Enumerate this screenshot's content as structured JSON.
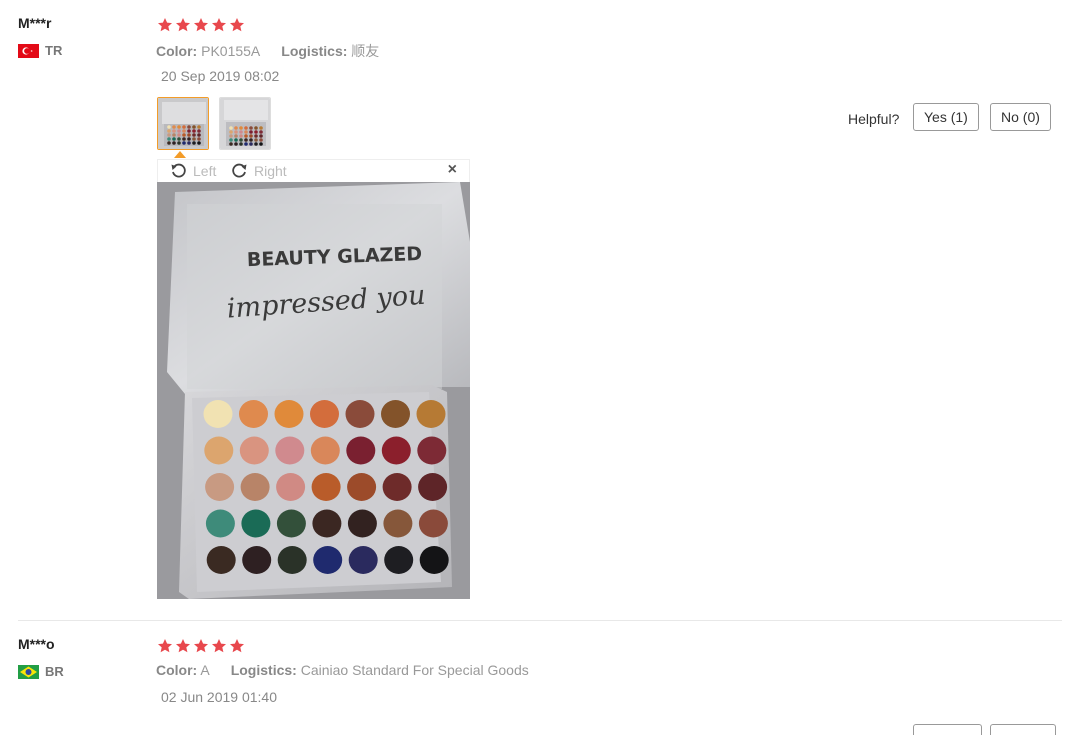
{
  "reviews": [
    {
      "user": "M***r",
      "country": "TR",
      "rating": 5,
      "color_label": "Color:",
      "color_value": "PK0155A",
      "logistics_label": "Logistics:",
      "logistics_value": "顺友",
      "date": "20 Sep 2019 08:02",
      "helpful_label": "Helpful?",
      "yes_label": "Yes (1)",
      "no_label": "No (0)",
      "viewer": {
        "rotate_left": "Left",
        "rotate_right": "Right",
        "close": "×"
      },
      "photo_text": {
        "brand": "BEAUTY GLAZED",
        "script": "impressed you"
      }
    },
    {
      "user": "M***o",
      "country": "BR",
      "rating": 5,
      "color_label": "Color:",
      "color_value": "A",
      "logistics_label": "Logistics:",
      "logistics_value": "Cainiao Standard For Special Goods",
      "date": "02 Jun 2019 01:40"
    }
  ],
  "colors": {
    "star": "#e8484d",
    "accent": "#f39c28"
  },
  "palette_colors": [
    [
      "#f1e2b2",
      "#df8a4e",
      "#e08a3a",
      "#d36d3c",
      "#8a4b3a",
      "#83532a",
      "#b67a34"
    ],
    [
      "#dca56e",
      "#d99480",
      "#d08a8e",
      "#d9875a",
      "#7a2030",
      "#8b1f2c",
      "#7d2a35"
    ],
    [
      "#c89a82",
      "#b88468",
      "#d08a84",
      "#b95c2a",
      "#9c4b2a",
      "#6e2b2a",
      "#5e2528"
    ],
    [
      "#3e8b7a",
      "#1a6b56",
      "#33503a",
      "#3b2722",
      "#322220",
      "#86573a",
      "#8a4a3a"
    ],
    [
      "#3a2a22",
      "#2e2022",
      "#2a3228",
      "#1f2a6e",
      "#2a2a5e",
      "#1e1e22",
      "#141416"
    ]
  ]
}
